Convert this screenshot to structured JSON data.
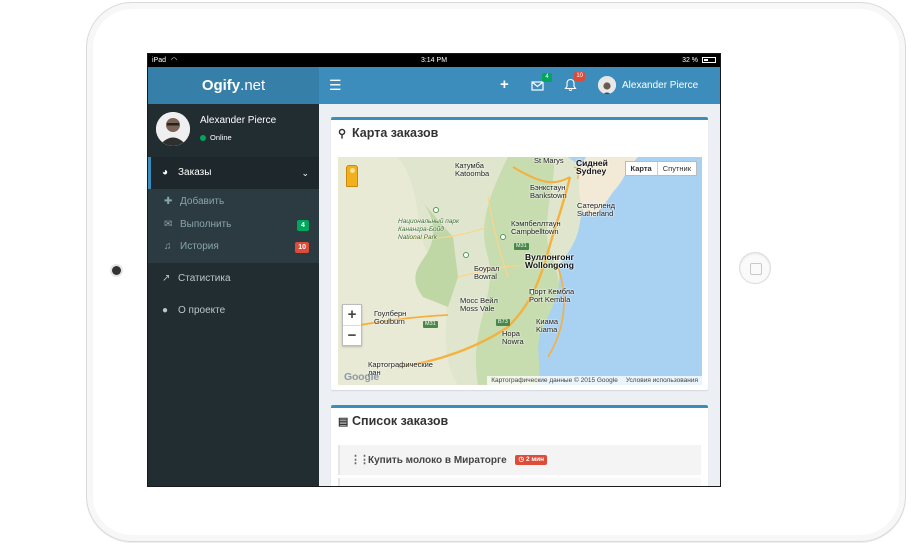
{
  "device": {
    "status_left": "iPad",
    "status_time": "3:14 PM",
    "status_battery": "32 %"
  },
  "header": {
    "logo_bold": "Ogify",
    "logo_rest": ".net",
    "toggle_icon": "hamburger-icon",
    "add_icon": "plus-icon",
    "messages_count": "4",
    "notifications_count": "10",
    "user_name": "Alexander Pierce"
  },
  "sidebar": {
    "user_name": "Alexander Pierce",
    "user_status": "Online",
    "menu": {
      "orders": "Заказы",
      "orders_sub": [
        {
          "label": "Добавить",
          "icon": "plus-icon"
        },
        {
          "label": "Выполнить",
          "icon": "envelope-icon",
          "badge": "4",
          "badge_color": "#00a65a"
        },
        {
          "label": "История",
          "icon": "bell-icon",
          "badge": "10",
          "badge_color": "#dd4b39"
        }
      ],
      "stats": "Статистика",
      "about": "О проекте"
    }
  },
  "map_box": {
    "title": "Карта заказов",
    "type_map": "Карта",
    "type_satellite": "Спутник",
    "zoom_in": "+",
    "zoom_out": "−",
    "logo": "Google",
    "attribution": "Картографические данные © 2015 Google",
    "terms": "Условия использования",
    "places": {
      "katoomba": "Катумба\nKatoomba",
      "st_marys": "St Marys",
      "sydney": "Сидней\nSydney",
      "bankstown": "Бэнкстаун\nBankstown",
      "sutherland": "Сатерленд\nSutherland",
      "park": "Национальный парк\nКанангра-Бойд\nNational Park",
      "campbelltown": "Кэмпбеллтаун\nCampbelltown",
      "wollongong": "Вуллонгонг\nWollongong",
      "bowral": "Боурал\nBowral",
      "port_kembla": "Порт Кембла\nPort Kembla",
      "moss_vale": "Мосс Вейл\nMoss Vale",
      "goulburn": "Гоулберн\nGoulburn",
      "kiama": "Киама\nKiama",
      "nowra": "Нора\nNowra",
      "bottom": "Картографические\nдан"
    },
    "highways": [
      "M31",
      "M31",
      "B73"
    ]
  },
  "list_box": {
    "title": "Список заказов",
    "tasks": [
      {
        "text": "Купить молоко в Мираторге",
        "time": "2 мин"
      }
    ]
  },
  "colors": {
    "primary": "#3c8dbc",
    "logo_bg": "#367fa9",
    "sidebar": "#222d32",
    "success": "#00a65a",
    "danger": "#dd4b39"
  }
}
